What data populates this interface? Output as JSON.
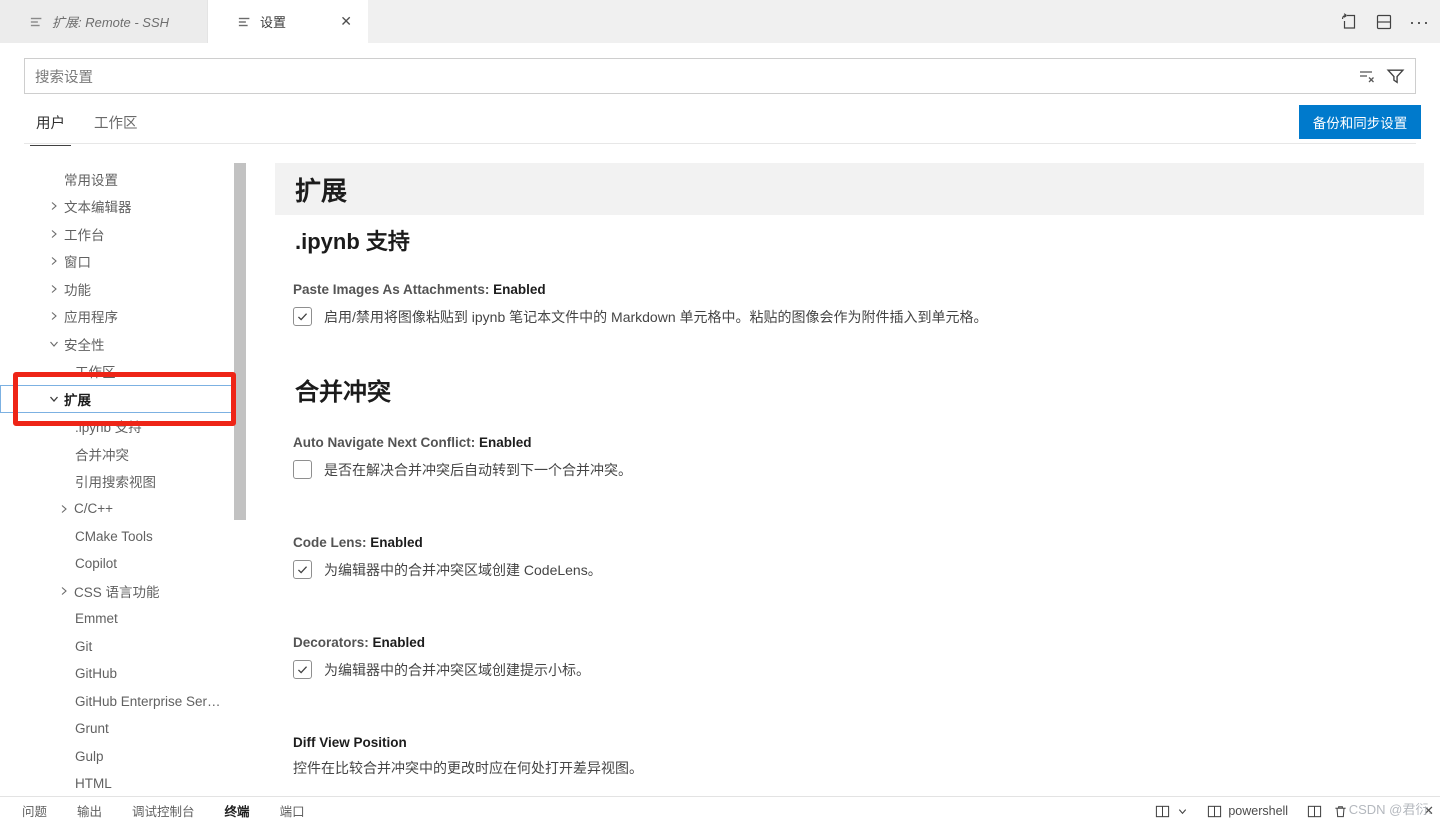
{
  "editor": {
    "tabs": [
      {
        "label": "扩展: Remote - SSH"
      },
      {
        "label": "设置"
      }
    ],
    "actions": {
      "more": "···",
      "close": "✕"
    }
  },
  "search": {
    "placeholder": "搜索设置"
  },
  "scope": {
    "tabs": [
      "用户",
      "工作区"
    ],
    "sync_button": "备份和同步设置"
  },
  "toc": {
    "items": [
      {
        "label": "常用设置"
      },
      {
        "label": "文本编辑器"
      },
      {
        "label": "工作台"
      },
      {
        "label": "窗口"
      },
      {
        "label": "功能"
      },
      {
        "label": "应用程序"
      },
      {
        "label": "安全性"
      },
      {
        "label": "工作区"
      },
      {
        "label": "扩展"
      },
      {
        "label": ".ipynb 支持"
      },
      {
        "label": "合并冲突"
      },
      {
        "label": "引用搜索视图"
      },
      {
        "label": "C/C++"
      },
      {
        "label": "CMake Tools"
      },
      {
        "label": "Copilot"
      },
      {
        "label": "CSS 语言功能"
      },
      {
        "label": "Emmet"
      },
      {
        "label": "Git"
      },
      {
        "label": "GitHub"
      },
      {
        "label": "GitHub Enterprise Ser…"
      },
      {
        "label": "Grunt"
      },
      {
        "label": "Gulp"
      },
      {
        "label": "HTML"
      }
    ]
  },
  "content": {
    "section_title": "扩展",
    "group1": {
      "title": ".ipynb 支持"
    },
    "group2": {
      "title": "合并冲突"
    },
    "settings": [
      {
        "name": "Paste Images As Attachments:",
        "value": "Enabled",
        "description": "启用/禁用将图像粘贴到 ipynb 笔记本文件中的 Markdown 单元格中。粘贴的图像会作为附件插入到单元格。"
      },
      {
        "name": "Auto Navigate Next Conflict:",
        "value": "Enabled",
        "description": "是否在解决合并冲突后自动转到下一个合并冲突。"
      },
      {
        "name": "Code Lens:",
        "value": "Enabled",
        "description": "为编辑器中的合并冲突区域创建 CodeLens。"
      },
      {
        "name": "Decorators:",
        "value": "Enabled",
        "description": "为编辑器中的合并冲突区域创建提示小标。"
      },
      {
        "name": "Diff View Position",
        "value": "",
        "description": "控件在比较合并冲突中的更改时应在何处打开差异视图。"
      }
    ]
  },
  "panel": {
    "tabs": [
      "问题",
      "输出",
      "调试控制台",
      "终端",
      "端口"
    ],
    "terminal_name": "powershell",
    "close": "✕"
  },
  "watermark": {
    "text": "CSDN @君衍."
  },
  "colors": {
    "accent": "#007acc",
    "annotation_red": "#ee2517",
    "section_highlight": "#f2f2f2"
  }
}
